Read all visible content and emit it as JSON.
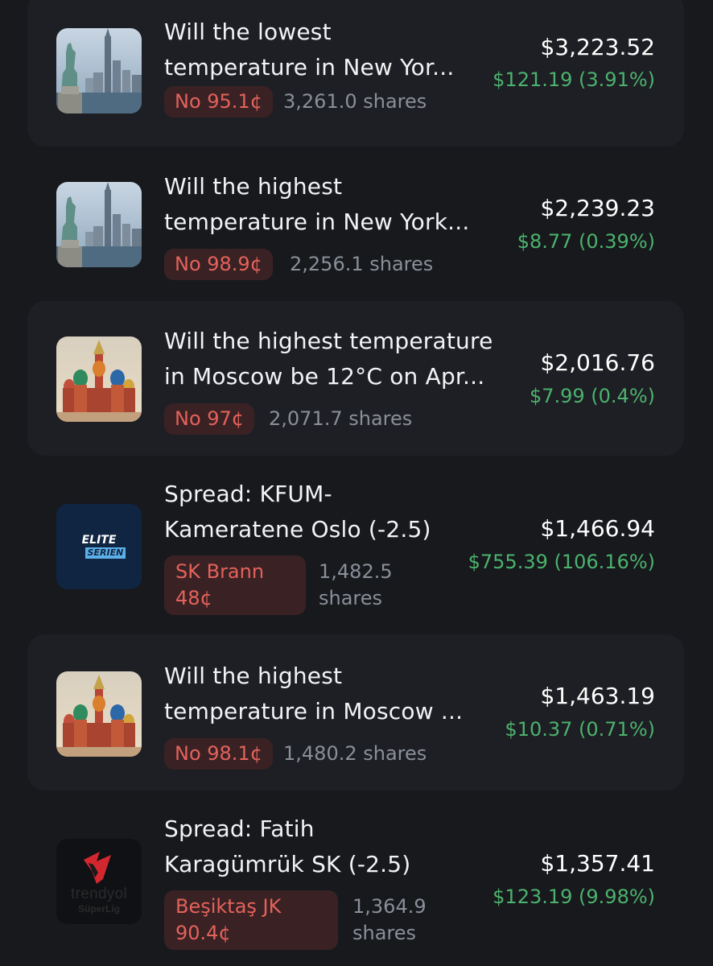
{
  "positions": [
    {
      "title_line1": "Will the lowest",
      "title_line2": "temperature in New Yor...",
      "outcome": "No 95.1¢",
      "shares": "3,261.0 shares",
      "value": "$3,223.52",
      "change": "$121.19 (3.91%)",
      "icon": "new-york-skyline-icon"
    },
    {
      "title_line1": "Will the highest",
      "title_line2": "temperature in New York...",
      "outcome": "No 98.9¢",
      "shares": "2,256.1 shares",
      "value": "$2,239.23",
      "change": "$8.77 (0.39%)",
      "icon": "new-york-skyline-icon"
    },
    {
      "title_line1": "Will the highest temperature",
      "title_line2": "in Moscow be 12°C on Apr...",
      "outcome": "No 97¢",
      "shares": "2,071.7 shares",
      "value": "$2,016.76",
      "change": "$7.99 (0.4%)",
      "icon": "moscow-cathedral-icon"
    },
    {
      "title_line1": "Spread: KFUM-",
      "title_line2": "Kameratene Oslo (-2.5)",
      "outcome_line1": "SK Brann",
      "outcome_line2": "48¢",
      "shares_line1": "1,482.5",
      "shares_line2": "shares",
      "value": "$1,466.94",
      "change": "$755.39 (106.16%)",
      "icon": "eliteserien-logo-icon",
      "logo_text1": "ELITE",
      "logo_text2": "SERIEN"
    },
    {
      "title_line1": "Will the highest",
      "title_line2": "temperature in Moscow ...",
      "outcome": "No 98.1¢",
      "shares": "1,480.2 shares",
      "value": "$1,463.19",
      "change": "$10.37 (0.71%)",
      "icon": "moscow-cathedral-icon"
    },
    {
      "title_line1": "Spread: Fatih",
      "title_line2": "Karagümrük SK (-2.5)",
      "outcome_line1": "Beşiktaş JK",
      "outcome_line2": "90.4¢",
      "shares_line1": "1,364.9",
      "shares_line2": "shares",
      "value": "$1,357.41",
      "change": "$123.19 (9.98%)",
      "icon": "trendyol-superlig-logo-icon",
      "logo_text1": "trendyol",
      "logo_text2": "SüperLig"
    }
  ],
  "colors": {
    "background": "#17191d",
    "card": "#1d1f24",
    "negative_pill_bg": "#3a2224",
    "negative_text": "#e4625b",
    "positive_text": "#4cb26d",
    "muted_text": "#8a8f98"
  }
}
